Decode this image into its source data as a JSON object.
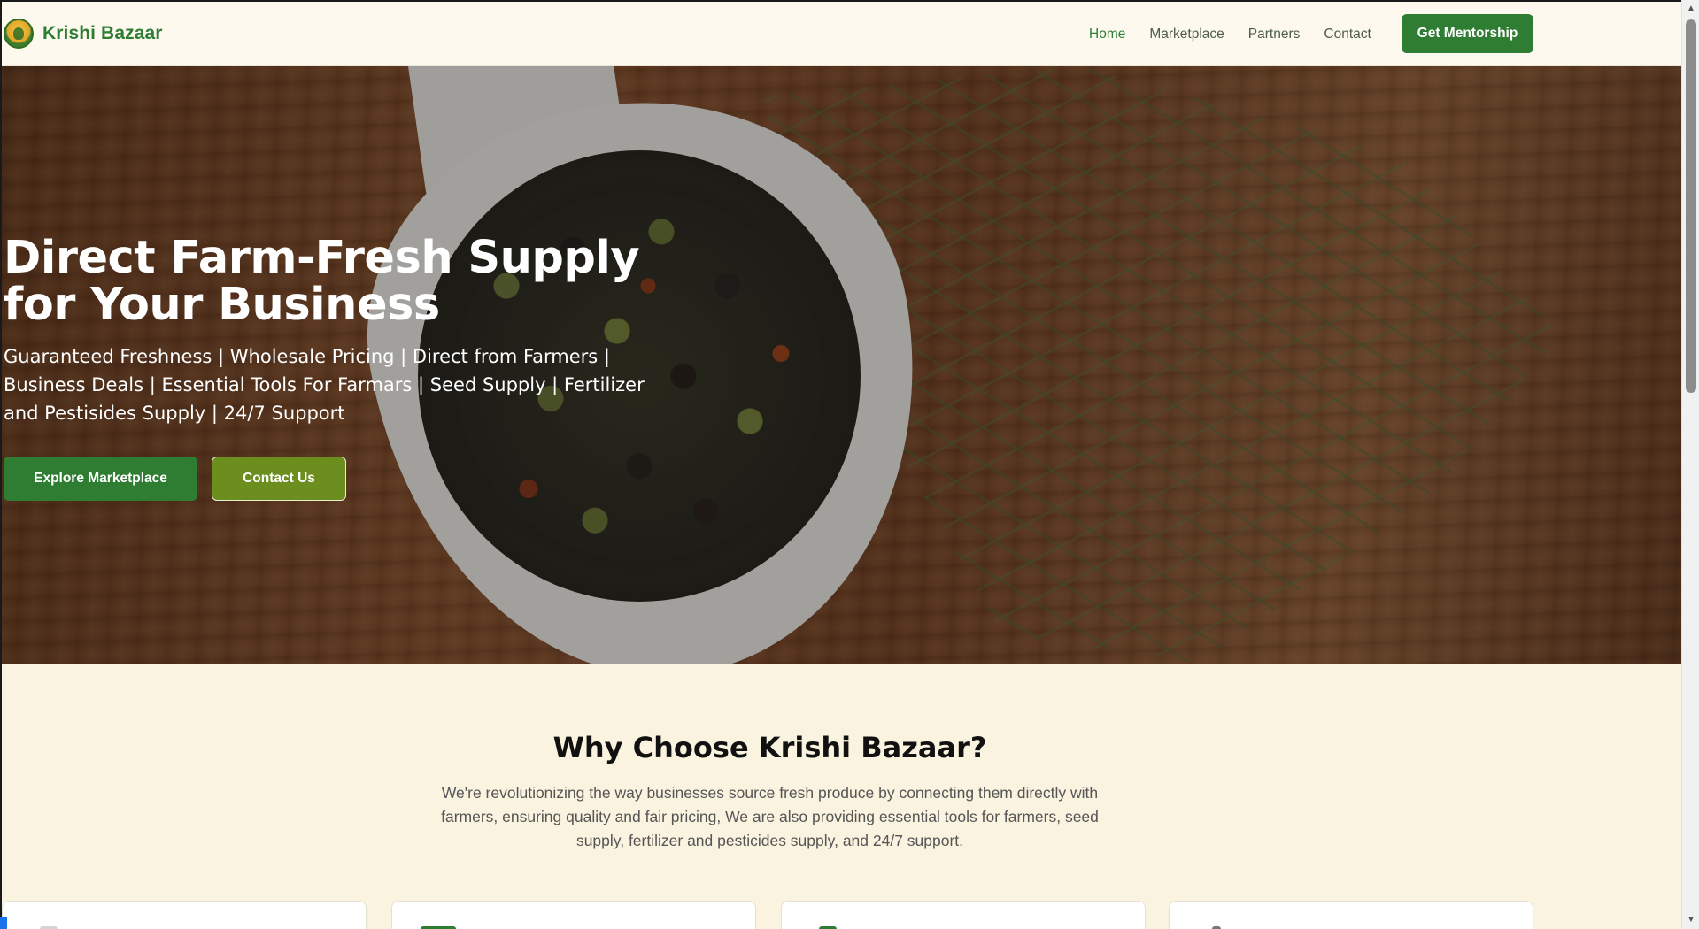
{
  "brand": {
    "name": "Krishi Bazaar",
    "logo_icon": "krishi-bazaar-logo"
  },
  "nav": {
    "links": [
      {
        "label": "Home",
        "active": true
      },
      {
        "label": "Marketplace",
        "active": false
      },
      {
        "label": "Partners",
        "active": false
      },
      {
        "label": "Contact",
        "active": false
      }
    ],
    "cta_label": "Get Mentorship"
  },
  "hero": {
    "title": "Direct Farm-Fresh Supply for Your Business",
    "subtitle": "Guaranteed Freshness | Wholesale Pricing | Direct from Farmers | Business Deals | Essential Tools For Farmars | Seed Supply | Fertilizer and Pestisides Supply | 24/7 Support",
    "primary_button": "Explore Marketplace",
    "secondary_button": "Contact Us"
  },
  "why": {
    "title": "Why Choose Krishi Bazaar?",
    "text": "We're revolutionizing the way businesses source fresh produce by connecting them directly with farmers, ensuring quality and fair pricing, We are also providing essential tools for farmers, seed supply, fertilizer and pesticides supply, and 24/7 support."
  },
  "colors": {
    "primary_green": "#2e7d32",
    "olive_green": "#6b8e1f",
    "page_background": "#faf3e0",
    "nav_background": "#fdf9ef"
  }
}
